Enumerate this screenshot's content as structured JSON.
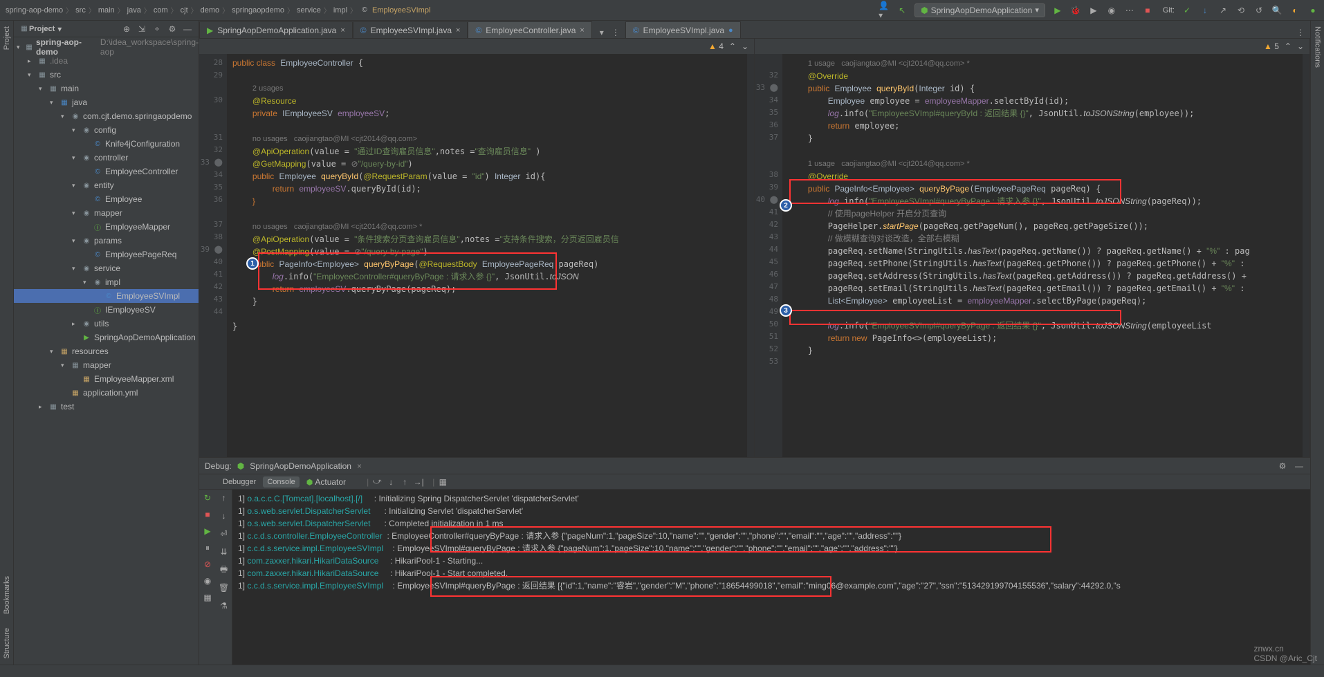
{
  "breadcrumb": [
    "spring-aop-demo",
    "src",
    "main",
    "java",
    "com",
    "cjt",
    "demo",
    "springaopdemo",
    "service",
    "impl"
  ],
  "breadcrumb_active": "EmployeeSVImpl",
  "run_config": "SpringAopDemoApplication",
  "panel": {
    "title": "Project",
    "root": "spring-aop-demo",
    "root_path": "D:\\idea_workspace\\spring-aop"
  },
  "tree": {
    "idea": ".idea",
    "src": "src",
    "main": "main",
    "java": "java",
    "pkg": "com.cjt.demo.springaopdemo",
    "config": "config",
    "knife": "Knife4jConfiguration",
    "controller": "controller",
    "ec": "EmployeeController",
    "entity": "entity",
    "emp": "Employee",
    "mapper": "mapper",
    "em": "EmployeeMapper",
    "params": "params",
    "epr": "EmployeePageReq",
    "service": "service",
    "impl": "impl",
    "svimpl": "EmployeeSVImpl",
    "isv": "IEmployeeSV",
    "utils": "utils",
    "app": "SpringAopDemoApplication",
    "resources": "resources",
    "mapper2": "mapper",
    "emx": "EmployeeMapper.xml",
    "yml": "application.yml",
    "test": "test"
  },
  "tabs": {
    "t1": "SpringAopDemoApplication.java",
    "t2": "EmployeeSVImpl.java",
    "t3": "EmployeeController.java",
    "t4": "EmployeeSVImpl.java"
  },
  "warn_left": "4",
  "warn_right": "5",
  "usage1": "2 usages",
  "usage2": "no usages   caojiangtao@MI <cjt2014@qq.com>",
  "usage3": "no usages   caojiangtao@MI <cjt2014@qq.com> *",
  "usage_r1": "1 usage   caojiangtao@MI <cjt2014@qq.com> *",
  "lines_left": [
    "29",
    "30",
    "",
    "31",
    "32",
    "33",
    "34",
    "35",
    "36",
    "",
    "37",
    "38",
    "39",
    "40",
    "41",
    "42",
    "43",
    "44"
  ],
  "lines_right": [
    "32",
    "33",
    "34",
    "35",
    "36",
    "37",
    "",
    "",
    "38",
    "39",
    "40",
    "41",
    "42",
    "43",
    "44",
    "45",
    "46",
    "47",
    "48",
    "49",
    "50",
    "51",
    "52",
    "53"
  ],
  "debug": {
    "title": "Debug:",
    "app": "SpringAopDemoApplication",
    "t_debugger": "Debugger",
    "t_console": "Console",
    "t_actuator": "Actuator"
  },
  "console_lines": [
    {
      "p": "1]",
      "src": "o.a.c.c.C.[Tomcat].[localhost].[/]",
      "msg": ": Initializing Spring DispatcherServlet 'dispatcherServlet'"
    },
    {
      "p": "1]",
      "src": "o.s.web.servlet.DispatcherServlet",
      "msg": ": Initializing Servlet 'dispatcherServlet'"
    },
    {
      "p": "1]",
      "src": "o.s.web.servlet.DispatcherServlet",
      "msg": ": Completed initialization in 1 ms"
    },
    {
      "p": "1]",
      "src": "c.c.d.s.controller.EmployeeController",
      "msg": ": EmployeeController#queryByPage : 请求入参 {\"pageNum\":1,\"pageSize\":10,\"name\":\"\",\"gender\":\"\",\"phone\":\"\",\"email\":\"\",\"age\":\"\",\"address\":\"\"}"
    },
    {
      "p": "1]",
      "src": "c.c.d.s.service.impl.EmployeeSVImpl",
      "msg": ": EmployeeSVImpl#queryByPage : 请求入参 {\"pageNum\":1,\"pageSize\":10,\"name\":\"\",\"gender\":\"\",\"phone\":\"\",\"email\":\"\",\"age\":\"\",\"address\":\"\"}"
    },
    {
      "p": "1]",
      "src": "com.zaxxer.hikari.HikariDataSource",
      "msg": ": HikariPool-1 - Starting..."
    },
    {
      "p": "1]",
      "src": "com.zaxxer.hikari.HikariDataSource",
      "msg": ": HikariPool-1 - Start completed."
    },
    {
      "p": "1]",
      "src": "c.c.d.s.service.impl.EmployeeSVImpl",
      "msg": ": EmployeeSVImpl#queryByPage : 返回结果 [{\"id\":1,\"name\":\"睿岩\",\"gender\":\"M\",\"phone\":\"18654499018\",\"email\":\"ming06@example.com\",\"age\":\"27\",\"ssn\":\"513429199704155536\",\"salary\":44292.0,\"s"
    }
  ],
  "git_label": "Git:",
  "watermark1": "znwx.cn",
  "watermark2": "CSDN @Aric_Cjt"
}
